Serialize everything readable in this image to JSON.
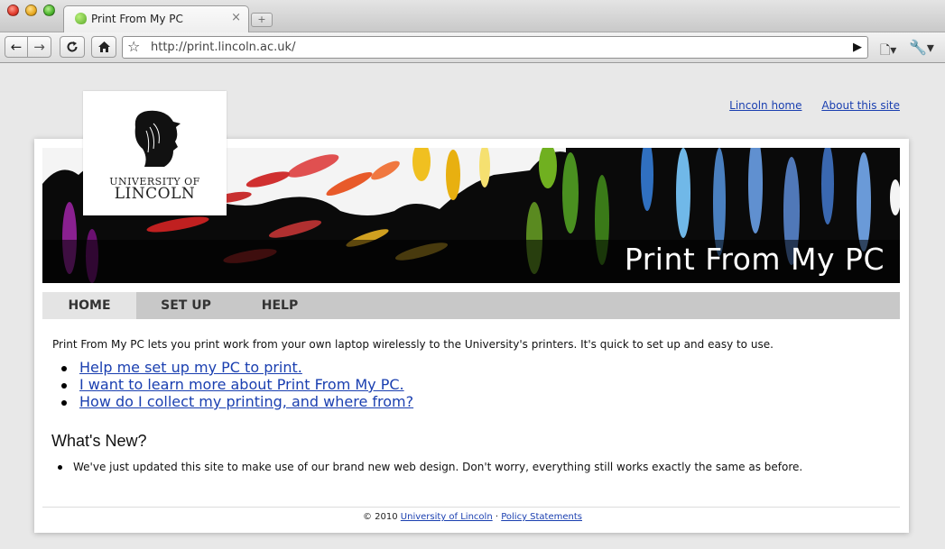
{
  "browser": {
    "tab_title": "Print From My PC",
    "tab_close": "×",
    "new_tab": "+",
    "url": "http://print.lincoln.ac.uk/",
    "icons": {
      "back": "←",
      "forward": "→",
      "reload": "C",
      "home": "⌂",
      "star": "☆",
      "go": "▶",
      "page_menu": "🗋▾",
      "wrench": "🔧▾"
    }
  },
  "page": {
    "top_links": [
      "Lincoln home",
      "About this site"
    ],
    "logo": {
      "line1": "UNIVERSITY OF",
      "line2": "LINCOLN"
    },
    "banner_title": "Print From My PC",
    "menu": [
      "HOME",
      "SET UP",
      "HELP"
    ],
    "active_menu": "HOME",
    "intro": "Print From My PC lets you print work from your own laptop wirelessly to the University's printers. It's quick to set up and easy to use.",
    "links": [
      "Help me set up my PC to print.",
      "I want to learn more about Print From My PC.",
      "How do I collect my printing, and where from?"
    ],
    "whats_new_heading": "What's New?",
    "news": [
      "We've just updated this site to make use of our brand new web design. Don't worry, everything still works exactly the same as before."
    ],
    "footer": {
      "copyright": "© 2010 ",
      "university_link": "University of Lincoln",
      "separator": " · ",
      "policy_link": "Policy Statements"
    }
  },
  "colors": {
    "link": "#1a3fb0",
    "menu_bar": "#c8c8c8",
    "menu_active": "#e4e4e4",
    "banner_bg": "#0a0a0a"
  }
}
